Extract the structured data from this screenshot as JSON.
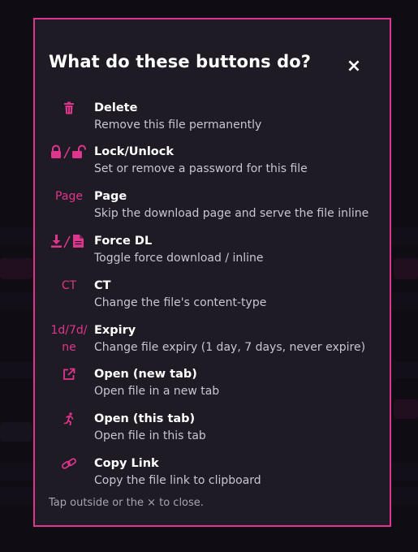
{
  "modal": {
    "title": "What do these buttons do?",
    "close_symbol": "×",
    "footer_note": "Tap outside or the × to close.",
    "accent_color": "#e0358f",
    "items": [
      {
        "icon": "trash-icon",
        "icon_text": "",
        "name": "Delete",
        "description": "Remove this file permanently"
      },
      {
        "icon": "lock-unlock-icon",
        "icon_text": "",
        "name": "Lock/Unlock",
        "description": "Set or remove a password for this file"
      },
      {
        "icon": "text",
        "icon_text": "Page",
        "name": "Page",
        "description": "Skip the download page and serve the file inline"
      },
      {
        "icon": "download-file-icon",
        "icon_text": "",
        "name": "Force DL",
        "description": "Toggle force download / inline"
      },
      {
        "icon": "text",
        "icon_text": "CT",
        "name": "CT",
        "description": "Change the file's content-type"
      },
      {
        "icon": "text",
        "icon_text_line1": "1d/7d/",
        "icon_text_line2": "ne",
        "name": "Expiry",
        "description": "Change file expiry (1 day, 7 days, never expire)"
      },
      {
        "icon": "external-link-icon",
        "icon_text": "",
        "name": "Open (new tab)",
        "description": "Open file in a new tab"
      },
      {
        "icon": "running-person-icon",
        "icon_text": "",
        "name": "Open (this tab)",
        "description": "Open file in this tab"
      },
      {
        "icon": "link-icon",
        "icon_text": "",
        "name": "Copy Link",
        "description": "Copy the file link to clipboard"
      }
    ]
  }
}
